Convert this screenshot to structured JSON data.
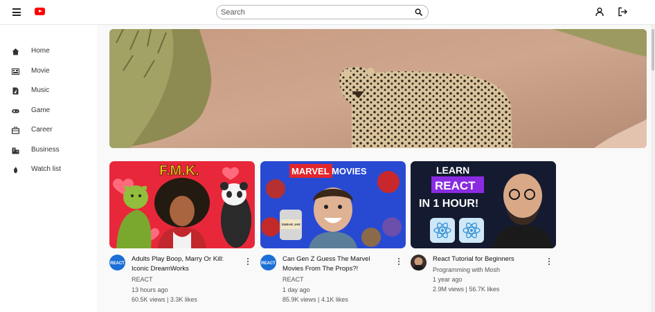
{
  "header": {
    "search": {
      "placeholder": "Search"
    },
    "icons": [
      "menu-icon",
      "youtube-logo-icon",
      "search-icon",
      "user-icon",
      "logout-icon"
    ]
  },
  "sidebar": {
    "items": [
      {
        "label": "Home",
        "icon": "home-icon"
      },
      {
        "label": "Movie",
        "icon": "movie-icon"
      },
      {
        "label": "Music",
        "icon": "music-icon"
      },
      {
        "label": "Game",
        "icon": "game-icon"
      },
      {
        "label": "Career",
        "icon": "career-icon"
      },
      {
        "label": "Business",
        "icon": "business-icon"
      },
      {
        "label": "Watch list",
        "icon": "watch-list-icon"
      }
    ]
  },
  "videos": [
    {
      "thumb_text": "F.M.K.",
      "title_line1": "Adults Play Boop, Marry Or Kill:",
      "title_line2": "Iconic DreamWorks",
      "avatar_text": "REACT",
      "channel": "REACT",
      "age": "13 hours ago",
      "stats": "60.5K views | 3.3K likes"
    },
    {
      "thumb_text": "MARVEL MOVIES",
      "thumb_sub": "SWEAR JAR",
      "title_line1": "Can Gen Z Guess The Marvel",
      "title_line2": "Movies From The Props?!",
      "avatar_text": "REACT",
      "channel": "REACT",
      "age": "1 day ago",
      "stats": "85.9K views | 4.1K likes"
    },
    {
      "thumb_line1": "LEARN",
      "thumb_line2": "REACT",
      "thumb_line3": "IN 1 HOUR!",
      "title_line1": "React Tutorial for Beginners",
      "channel": "Programming with Mosh",
      "age": "1 year ago",
      "stats": "2.9M views | 56.7K likes"
    }
  ],
  "colors": {
    "accent": "#ff0000",
    "text": "#111111",
    "meta": "#555555"
  }
}
